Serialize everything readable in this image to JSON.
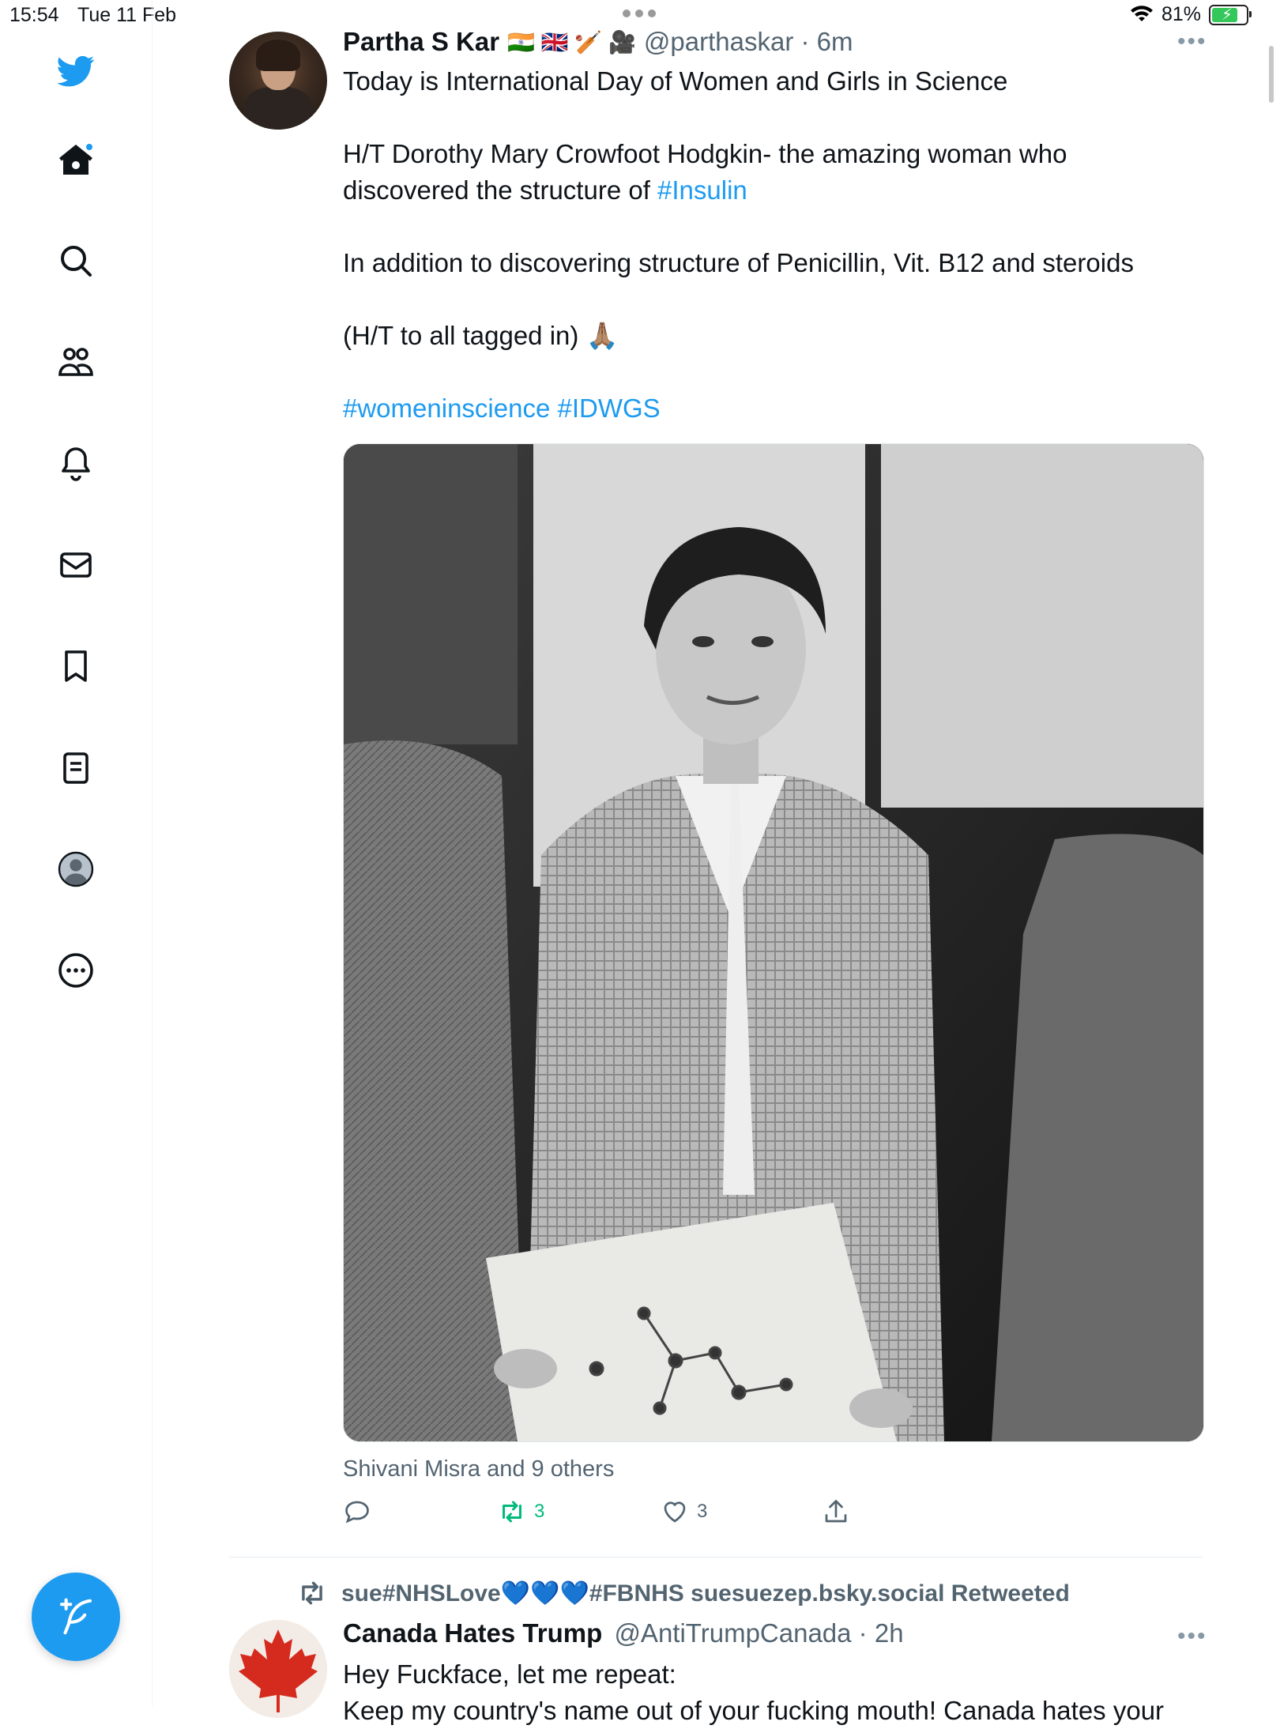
{
  "status_bar": {
    "time": "15:54",
    "date": "Tue 11 Feb",
    "battery_percent": "81%",
    "battery_level": 0.81
  },
  "sidebar": {
    "home_notification_dot": true,
    "items": [
      {
        "name": "twitter-logo-icon"
      },
      {
        "name": "home-icon"
      },
      {
        "name": "search-icon"
      },
      {
        "name": "communities-icon"
      },
      {
        "name": "notifications-icon"
      },
      {
        "name": "messages-icon"
      },
      {
        "name": "bookmarks-icon"
      },
      {
        "name": "lists-icon"
      },
      {
        "name": "profile-icon"
      },
      {
        "name": "more-icon"
      }
    ],
    "compose_icon": "compose-tweet-icon"
  },
  "tweet": {
    "author_name": "Partha S Kar",
    "author_emojis": "🇮🇳 🇬🇧 🏏 🎥",
    "handle_time": "@parthaskar · 6m",
    "text": {
      "line1": "Today is International Day of Women and Girls in Science",
      "para2_before": "H/T Dorothy Mary Crowfoot Hodgkin- the amazing woman who discovered the structure of ",
      "para2_tag": "#Insulin",
      "para3": "In addition to discovering structure of Penicillin, Vit. B12 and steroids",
      "para4": "(H/T to all tagged in) 🙏🏽",
      "hashtags": "#womeninscience #IDWGS"
    },
    "liked_by": "Shivani Misra and 9 others",
    "actions": {
      "reply_count": "",
      "retweet_count": "3",
      "like_count": "3"
    }
  },
  "next_tweet": {
    "retweeted_by": "sue#NHSLove💙💙💙#FBNHS suesuezep.bsky.social Retweeted",
    "author_name": "Canada Hates Trump",
    "handle_time": "@AntiTrumpCanada · 2h",
    "text_line1": "Hey Fuckface, let me repeat:",
    "text_line2": "Keep my country's name out of your fucking mouth! Canada hates your"
  },
  "colors": {
    "accent": "#1d9bf0",
    "retweet_green": "#00ba7c",
    "secondary_text": "#536471"
  }
}
